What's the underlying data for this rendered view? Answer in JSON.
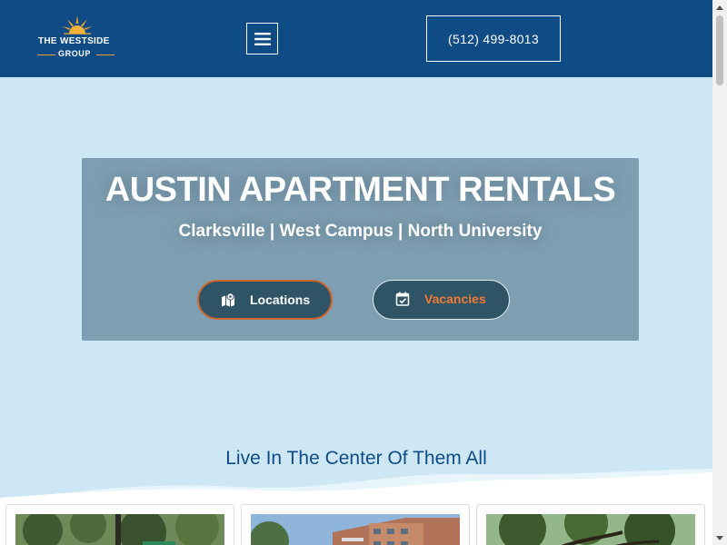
{
  "header": {
    "logo_line1": "THE WESTSIDE",
    "logo_line2": "GROUP",
    "menu_icon": "hamburger-menu-icon",
    "phone": "(512) 499-8013",
    "background": "#0f4c86"
  },
  "hero": {
    "title": "AUSTIN APARTMENT RENTALS",
    "subtitle": "Clarksville | West Campus | North University",
    "buttons": [
      {
        "label": "Locations",
        "icon": "map-pin-icon"
      },
      {
        "label": "Vacancies",
        "icon": "calendar-check-icon"
      }
    ]
  },
  "section": {
    "title": "Live In The Center Of Them All"
  },
  "cards": [
    {
      "image": "tree-street-photo"
    },
    {
      "image": "apartment-building-photo"
    },
    {
      "image": "oak-tree-photo"
    }
  ],
  "colors": {
    "page_background": "#cde8f4",
    "accent_orange": "#f07a35",
    "button_fill": "#2f5466",
    "hero_box": "#7e9fb2"
  }
}
